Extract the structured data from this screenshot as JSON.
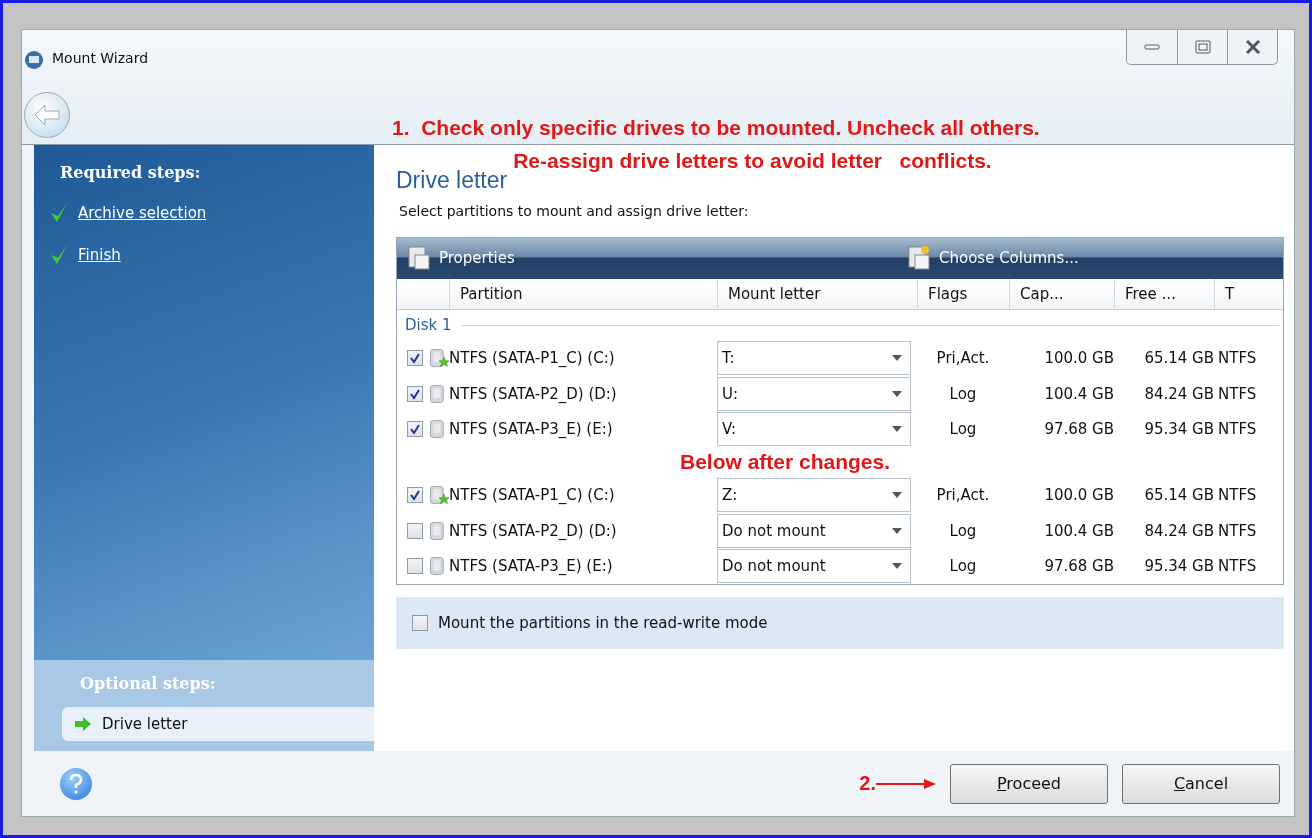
{
  "window": {
    "title": "Mount Wizard"
  },
  "annotations": {
    "top": [
      "1.  Check only specific drives to be mounted. Uncheck all others.",
      "Re-assign drive letters to avoid letter   conflicts."
    ],
    "step_2": "2."
  },
  "sidebar": {
    "required_title": "Required steps:",
    "required_steps": [
      {
        "label": "Archive selection",
        "done": true
      },
      {
        "label": "Finish",
        "done": true
      }
    ],
    "optional_title": "Optional steps:",
    "optional_steps": [
      {
        "label": "Drive letter",
        "selected": true
      }
    ]
  },
  "content": {
    "heading": "Drive letter",
    "instruction": "Select partitions to mount and assign drive letter:"
  },
  "toolbar": [
    "Properties",
    "Choose Columns..."
  ],
  "table": {
    "columns": [
      "Partition",
      "Mount letter",
      "Flags",
      "Cap...",
      "Free ...",
      "T"
    ],
    "rows": [
      {
        "kind": "group",
        "label": "Disk 1"
      },
      {
        "kind": "partition",
        "checked": true,
        "system": true,
        "partition": "NTFS (SATA-P1_C) (C:)",
        "mount_letter": "T:",
        "flags": "Pri,Act.",
        "capacity": "100.0 GB",
        "free": "65.14 GB",
        "type": "NTFS"
      },
      {
        "kind": "partition",
        "checked": true,
        "system": false,
        "partition": "NTFS (SATA-P2_D) (D:)",
        "mount_letter": "U:",
        "flags": "Log",
        "capacity": "100.4 GB",
        "free": "84.24 GB",
        "type": "NTFS"
      },
      {
        "kind": "partition",
        "checked": true,
        "system": false,
        "partition": "NTFS (SATA-P3_E) (E:)",
        "mount_letter": "V:",
        "flags": "Log",
        "capacity": "97.68 GB",
        "free": "95.34 GB",
        "type": "NTFS"
      },
      {
        "kind": "annotation",
        "label": "Below after changes."
      },
      {
        "kind": "partition",
        "checked": true,
        "system": true,
        "partition": "NTFS (SATA-P1_C) (C:)",
        "mount_letter": "Z:",
        "flags": "Pri,Act.",
        "capacity": "100.0 GB",
        "free": "65.14 GB",
        "type": "NTFS"
      },
      {
        "kind": "partition",
        "checked": false,
        "system": false,
        "partition": "NTFS (SATA-P2_D) (D:)",
        "mount_letter": "Do not mount",
        "flags": "Log",
        "capacity": "100.4 GB",
        "free": "84.24 GB",
        "type": "NTFS"
      },
      {
        "kind": "partition",
        "checked": false,
        "system": false,
        "partition": "NTFS (SATA-P3_E) (E:)",
        "mount_letter": "Do not mount",
        "flags": "Log",
        "capacity": "97.68 GB",
        "free": "95.34 GB",
        "type": "NTFS"
      }
    ]
  },
  "read_write_option": {
    "label": "Mount the partitions in the read-write mode",
    "checked": false
  },
  "buttons": [
    "Proceed",
    "Cancel"
  ]
}
